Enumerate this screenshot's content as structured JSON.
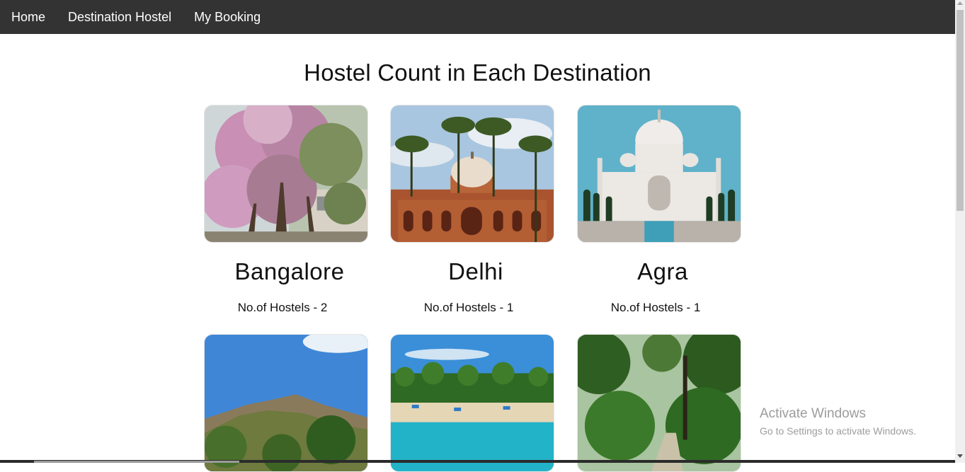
{
  "nav": {
    "items": [
      {
        "label": "Home"
      },
      {
        "label": "Destination Hostel"
      },
      {
        "label": "My Booking"
      }
    ]
  },
  "page": {
    "title": "Hostel Count in Each Destination"
  },
  "destinations": [
    {
      "name": "Bangalore",
      "count_text": "No.of Hostels - 2",
      "image_icon": "flowering-tree-photo"
    },
    {
      "name": "Delhi",
      "count_text": "No.of Hostels - 1",
      "image_icon": "humayuns-tomb-photo"
    },
    {
      "name": "Agra",
      "count_text": "No.of Hostels - 1",
      "image_icon": "taj-mahal-photo"
    },
    {
      "name": "",
      "count_text": "",
      "image_icon": "mountain-hill-photo"
    },
    {
      "name": "",
      "count_text": "",
      "image_icon": "beach-photo"
    },
    {
      "name": "",
      "count_text": "",
      "image_icon": "forest-path-photo"
    }
  ],
  "watermark": {
    "title": "Activate Windows",
    "subtitle": "Go to Settings to activate Windows."
  },
  "colors": {
    "navbar": "#333333",
    "nav_text": "#ffffff",
    "background": "#ffffff"
  }
}
